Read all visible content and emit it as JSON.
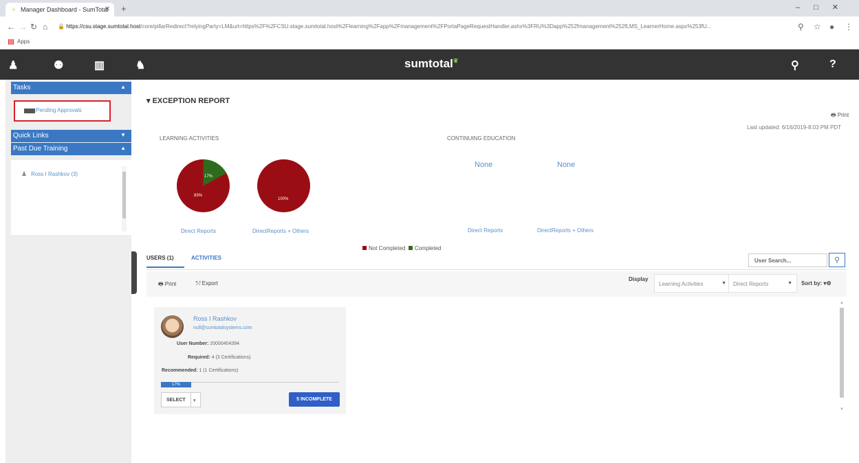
{
  "browser": {
    "tab_title": "Manager Dashboard - SumTotal",
    "url_domain": "https://csu.stage.sumtotal.host",
    "url_path": "/core/pillarRedirect?relyingParty=LM&url=https%2F%2FCSU.stage.sumtotal.host%2Flearning%2Fapp%2Fmanagement%2FPortaPageRequestHandler.ashx%3FRU%3Dapp%252fmanagement%252fLMS_LearnerHome.aspx%253fU...",
    "apps_label": "Apps"
  },
  "header": {
    "logo": "sumtotal"
  },
  "sidebar": {
    "tasks_label": "Tasks",
    "pending_approvals": "Pending Approvals",
    "quick_links": "Quick Links",
    "past_due_training": "Past Due Training",
    "past_due_item": "Ross I Rashkov  (3)"
  },
  "report": {
    "title": "EXCEPTION REPORT",
    "print_label": "Print",
    "last_updated": "Last updated: 6/16/2019-8:03 PM PDT",
    "learning_activities": "LEARNING ACTIVITIES",
    "continuing_education": "CONTINUING EDUCATION",
    "pie1_not_completed_label": "83%",
    "pie1_completed_label": "17%",
    "pie2_label": "100%",
    "ce_none1": "None",
    "ce_none2": "None",
    "link_direct_reports": "Direct Reports",
    "link_direct_reports_others": "DirectReports + Others",
    "legend_not_completed": "Not Completed",
    "legend_completed": "Completed"
  },
  "chart_data": [
    {
      "type": "pie",
      "title": "",
      "categories": [
        "Not Completed",
        "Completed"
      ],
      "values": [
        83,
        17
      ],
      "caption": "Direct Reports"
    },
    {
      "type": "pie",
      "title": "",
      "categories": [
        "Not Completed",
        "Completed"
      ],
      "values": [
        100,
        0
      ],
      "caption": "DirectReports + Others"
    }
  ],
  "tabs": {
    "users": "USERS (1)",
    "activities": "ACTIVITIES"
  },
  "search": {
    "placeholder": "User Search..."
  },
  "toolbar": {
    "print": "Print",
    "export": "Export",
    "display": "Display",
    "display_value1": "Learning Activities",
    "display_value2": "Direct Reports",
    "sort_by": "Sort by:"
  },
  "user_card": {
    "name": "Ross I Rashkov",
    "email": "null@sumtotalsystems.com",
    "user_number_label": "User Number:",
    "user_number": "20000404394",
    "required_label": "Required:",
    "required": "4 (3 Certifications)",
    "recommended_label": "Recommended:",
    "recommended": "1 (1 Certifications)",
    "progress_label": "17%",
    "progress_fraction": 0.17,
    "select_label": "SELECT",
    "incomplete_label": "5 INCOMPLETE"
  },
  "colors": {
    "not_completed": "#9b0d14",
    "completed": "#2f6b1c",
    "accent": "#3a78c3",
    "header": "#333333"
  }
}
